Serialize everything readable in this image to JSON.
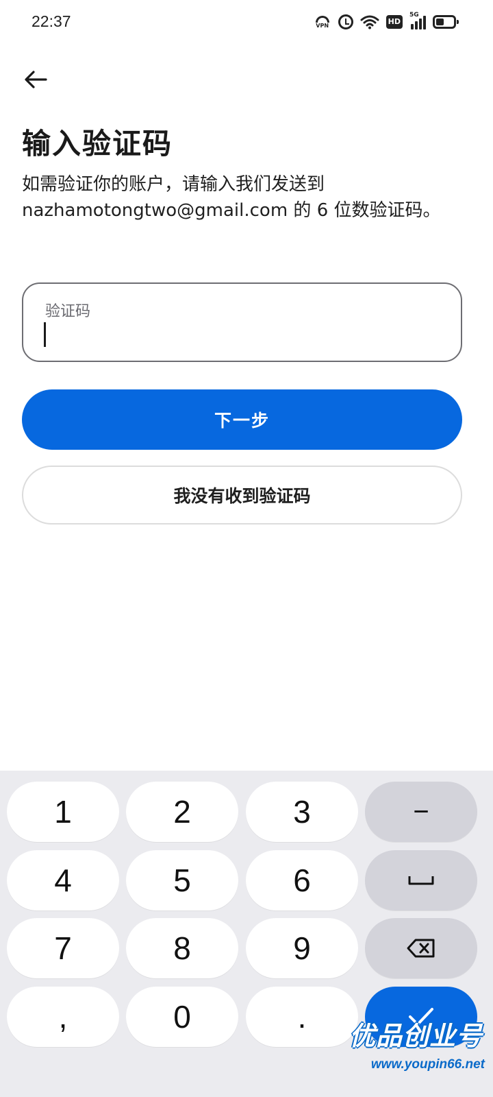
{
  "status_bar": {
    "time": "22:37",
    "vpn_label": "VPN",
    "hd_label": "HD",
    "network_label": "5G",
    "icons": [
      "vpn-icon",
      "alarm-icon",
      "wifi-icon",
      "hd-icon",
      "signal-5g-icon",
      "battery-icon"
    ]
  },
  "header": {
    "back_icon": "arrow-left-icon",
    "title": "输入验证码"
  },
  "description": "如需验证你的账户，请输入我们发送到 nazhamotongtwo@gmail.com 的 6 位数验证码。",
  "code_field": {
    "label": "验证码",
    "value": ""
  },
  "buttons": {
    "next": "下一步",
    "no_code": "我没有收到验证码"
  },
  "keypad": {
    "keys": [
      {
        "label": "1"
      },
      {
        "label": "2"
      },
      {
        "label": "3"
      },
      {
        "label": "−",
        "icon": "minus-icon"
      },
      {
        "label": "4"
      },
      {
        "label": "5"
      },
      {
        "label": "6"
      },
      {
        "label": "",
        "icon": "space-icon"
      },
      {
        "label": "7"
      },
      {
        "label": "8"
      },
      {
        "label": "9"
      },
      {
        "label": "",
        "icon": "backspace-icon"
      },
      {
        "label": ","
      },
      {
        "label": "0"
      },
      {
        "label": "."
      },
      {
        "label": "",
        "icon": "check-icon"
      }
    ]
  },
  "colors": {
    "primary": "#0768df",
    "keypad_bg": "#ebebef",
    "func_key": "#d3d3da"
  },
  "watermark": {
    "brand": "优品创业号",
    "url": "www.youpin66.net"
  }
}
